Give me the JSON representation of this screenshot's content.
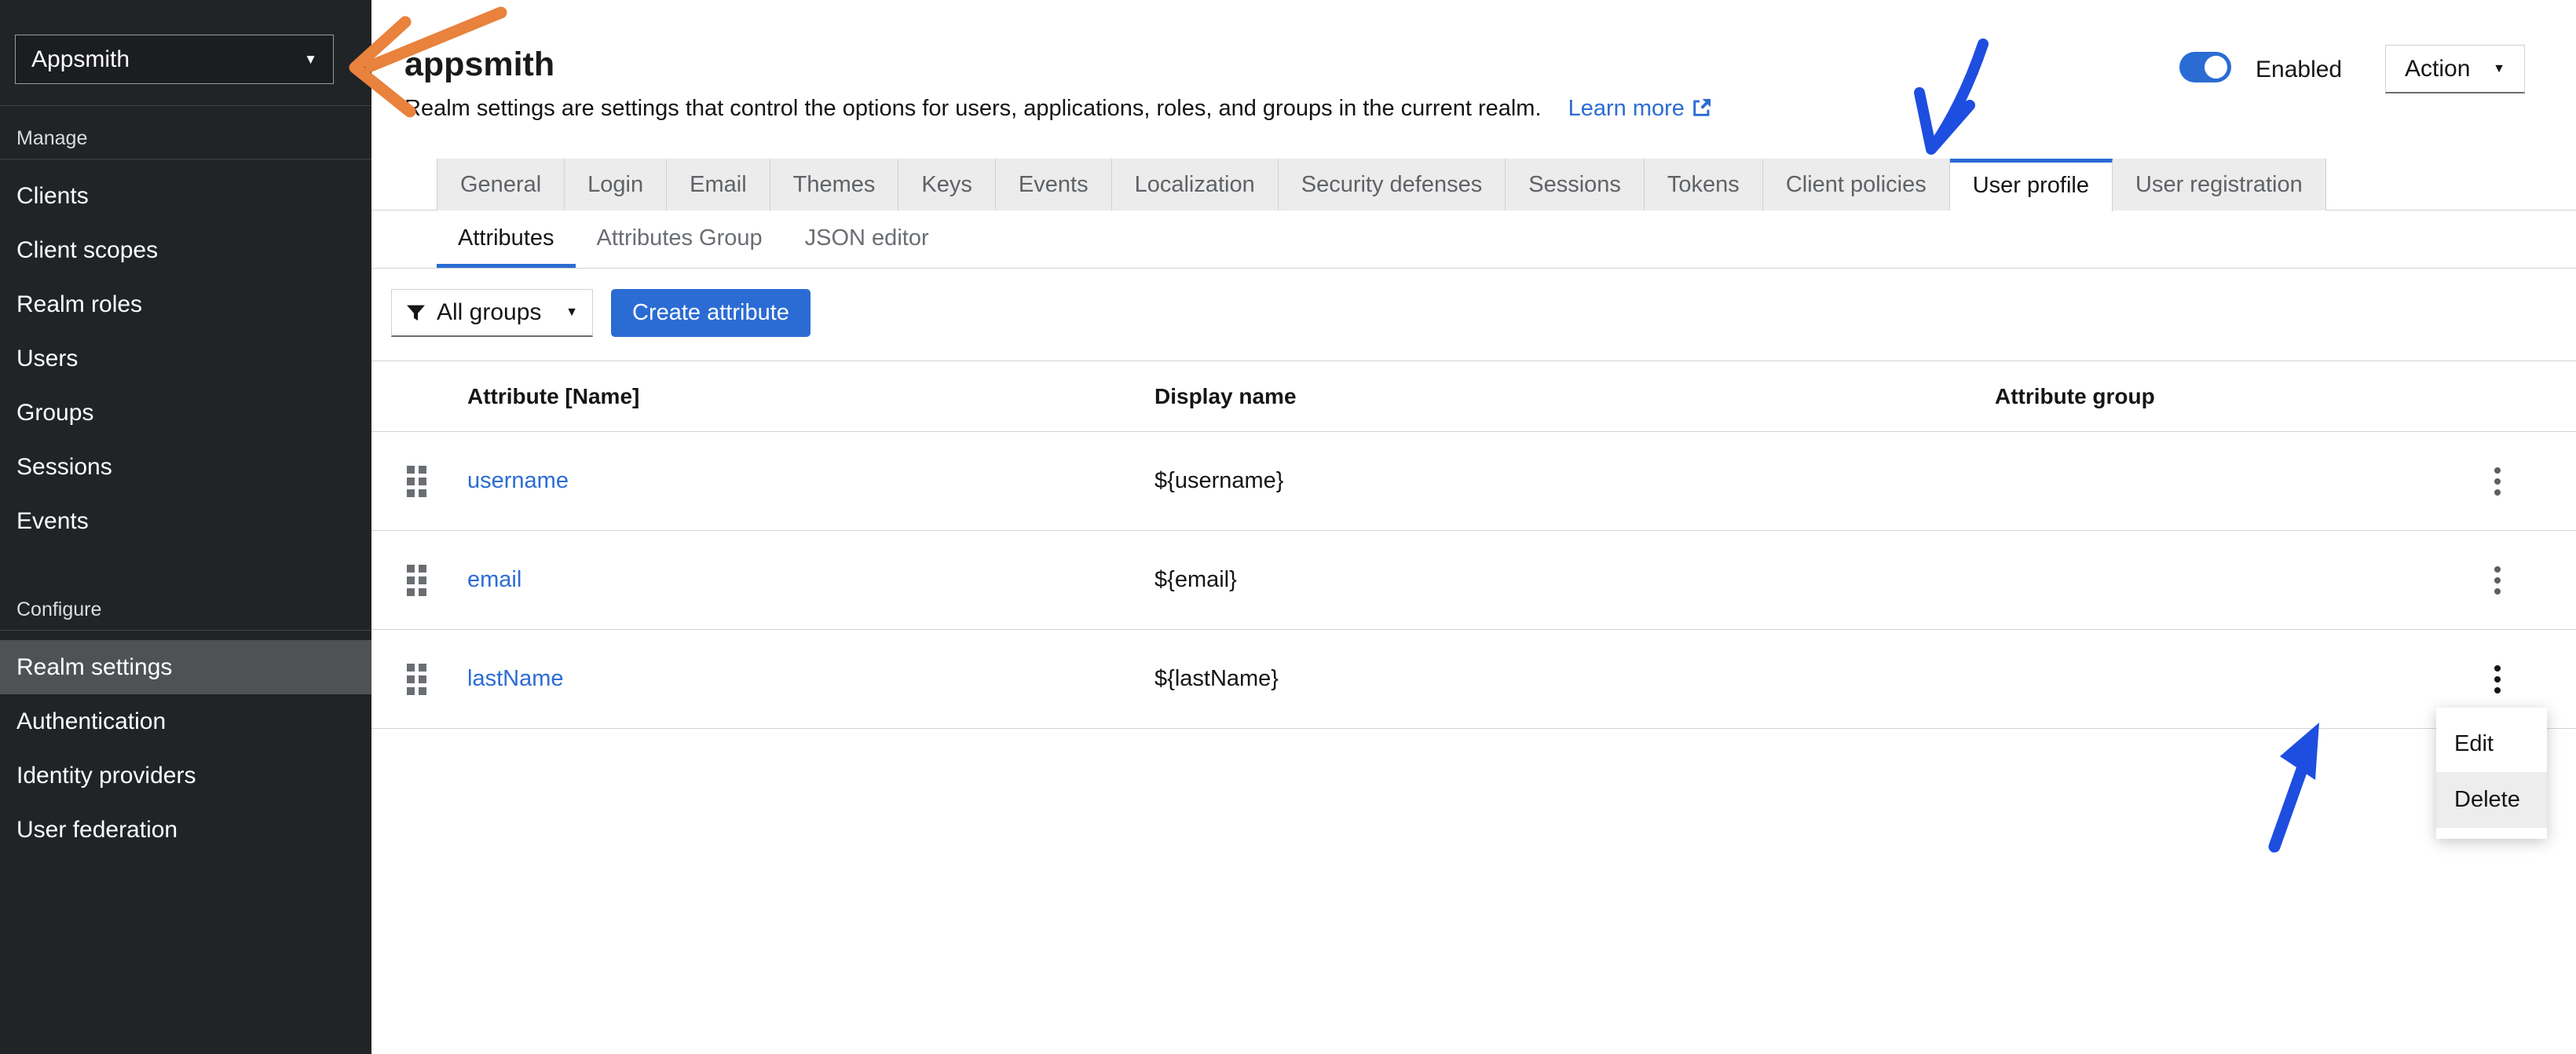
{
  "app": {
    "realm_selector": "Appsmith"
  },
  "icons": {
    "caret_down": "▼"
  },
  "sidebar": {
    "active_item": "Realm settings",
    "sections": [
      {
        "title": "Manage",
        "items": [
          "Clients",
          "Client scopes",
          "Realm roles",
          "Users",
          "Groups",
          "Sessions",
          "Events"
        ]
      },
      {
        "title": "Configure",
        "items": [
          "Realm settings",
          "Authentication",
          "Identity providers",
          "User federation"
        ]
      }
    ]
  },
  "header": {
    "title": "appsmith",
    "description": "Realm settings are settings that control the options for users, applications, roles, and groups in the current realm.",
    "learn_more_label": "Learn more",
    "enabled_label": "Enabled",
    "action_label": "Action"
  },
  "tabs": {
    "active": "User profile",
    "items": [
      "General",
      "Login",
      "Email",
      "Themes",
      "Keys",
      "Events",
      "Localization",
      "Security defenses",
      "Sessions",
      "Tokens",
      "Client policies",
      "User profile",
      "User registration"
    ]
  },
  "subtabs": {
    "active": "Attributes",
    "items": [
      "Attributes",
      "Attributes Group",
      "JSON editor"
    ]
  },
  "toolbar": {
    "group_filter_value": "All groups",
    "create_attribute_label": "Create attribute"
  },
  "attributes_table": {
    "columns": [
      "Attribute [Name]",
      "Display name",
      "Attribute group"
    ],
    "rows": [
      {
        "name": "username",
        "display_name": "${username}",
        "attribute_group": ""
      },
      {
        "name": "email",
        "display_name": "${email}",
        "attribute_group": ""
      },
      {
        "name": "lastName",
        "display_name": "${lastName}",
        "attribute_group": ""
      }
    ]
  },
  "context_menu": {
    "highlighted": "Delete",
    "items": [
      "Edit",
      "Delete"
    ]
  },
  "colors": {
    "accent_blue": "#2b6cd4",
    "sidebar_bg": "#212427",
    "active_nav_bg": "#4f5255",
    "delete_highlight": "#ededed",
    "annotation_orange": "#e8823c",
    "annotation_blue": "#1e4ee0"
  }
}
